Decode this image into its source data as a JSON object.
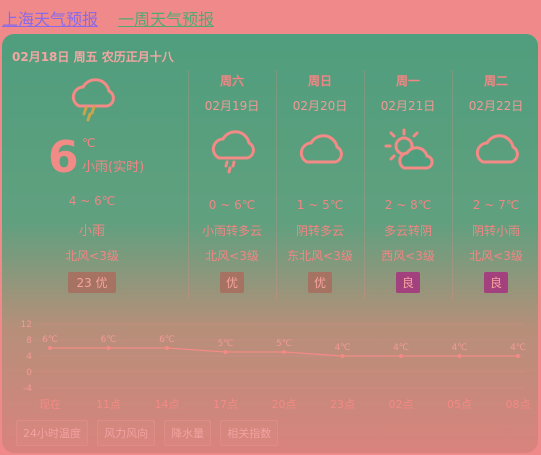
{
  "header": {
    "title": "上海天气预报",
    "subtitle": "一周天气预报"
  },
  "today": {
    "date": "02月18日 周五 农历正月十八",
    "icon": "cloud-rain-icon",
    "temp": "6",
    "unit": "℃",
    "condition_now": "小雨(实时)",
    "range": "4 ~ 6℃",
    "condition": "小雨",
    "wind": "北风<3级",
    "aqi": "23 优"
  },
  "forecast": [
    {
      "weekday": "周六",
      "date": "02月19日",
      "icon": "cloud-rain-icon",
      "range": "0 ~ 6℃",
      "condition": "小雨转多云",
      "wind": "北风<3级",
      "aqi": "优"
    },
    {
      "weekday": "周日",
      "date": "02月20日",
      "icon": "cloud-icon",
      "range": "1 ~ 5℃",
      "condition": "阴转多云",
      "wind": "东北风<3级",
      "aqi": "优"
    },
    {
      "weekday": "周一",
      "date": "02月21日",
      "icon": "sun-cloud-icon",
      "range": "2 ~ 8℃",
      "condition": "多云转阴",
      "wind": "西风<3级",
      "aqi": "良"
    },
    {
      "weekday": "周二",
      "date": "02月22日",
      "icon": "cloud-icon",
      "range": "2 ~ 7℃",
      "condition": "阴转小雨",
      "wind": "北风<3级",
      "aqi": "良"
    }
  ],
  "chart_data": {
    "type": "line",
    "categories": [
      "现在",
      "11点",
      "14点",
      "17点",
      "20点",
      "23点",
      "02点",
      "05点",
      "08点"
    ],
    "series": [
      {
        "values": [
          6,
          6,
          6,
          5,
          5,
          4,
          4,
          4,
          4
        ]
      }
    ],
    "data_labels": [
      "6℃",
      "6℃",
      "6℃",
      "5℃",
      "5℃",
      "4℃",
      "4℃",
      "4℃",
      "4℃"
    ],
    "yticks": [
      12,
      8,
      4,
      0,
      -4
    ],
    "ylim": [
      -4,
      12
    ],
    "color": "#f28a86"
  },
  "tabs": [
    "24小时温度",
    "风力风向",
    "降水量",
    "相关指数"
  ]
}
